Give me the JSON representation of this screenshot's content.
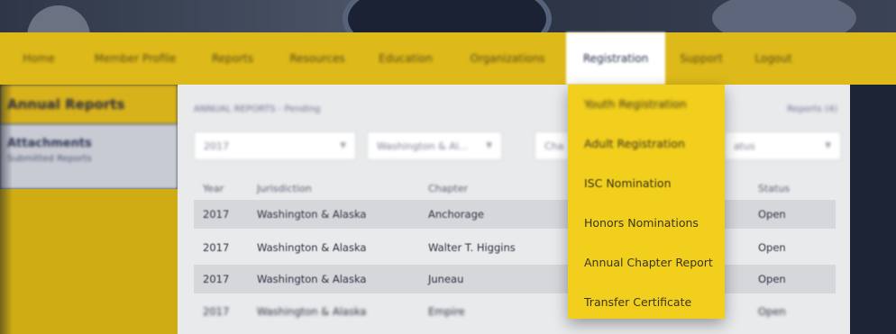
{
  "nav": {
    "items": [
      {
        "label": "Home"
      },
      {
        "label": "Member Profile"
      },
      {
        "label": "Reports"
      },
      {
        "label": "Resources"
      },
      {
        "label": "Education"
      },
      {
        "label": "Organizations"
      },
      {
        "label": "Registration",
        "active": true
      },
      {
        "label": "Support"
      },
      {
        "label": "Logout"
      }
    ]
  },
  "sidebar": {
    "title": "Annual Reports",
    "section_title": "Attachments",
    "section_subtitle": "Submitted Reports"
  },
  "main": {
    "breadcrumb": "ANNUAL REPORTS - Pending",
    "reports_link": "Reports (4)",
    "filters": {
      "year": "2017",
      "jurisdiction": "Washington & Al...",
      "chapter": "Cha",
      "status": "atus"
    },
    "table": {
      "headers": [
        "Year",
        "Jurisdiction",
        "Chapter",
        "Status"
      ],
      "rows": [
        [
          "2017",
          "Washington & Alaska",
          "Anchorage",
          "Open"
        ],
        [
          "2017",
          "Washington & Alaska",
          "Walter T. Higgins",
          "Open"
        ],
        [
          "2017",
          "Washington & Alaska",
          "Juneau",
          "Open"
        ],
        [
          "2017",
          "Washington & Alaska",
          "Empire",
          "Open"
        ]
      ]
    }
  },
  "dropdown": {
    "items": [
      "Youth Registration",
      "Adult Registration",
      "ISC Nomination",
      "Honors Nominations",
      "Annual Chapter Report",
      "Transfer Certificate"
    ]
  },
  "colors": {
    "nav_yellow": "#ddb91a",
    "dropdown_yellow": "#f2cf1c",
    "dark_navy": "#1d2435"
  }
}
